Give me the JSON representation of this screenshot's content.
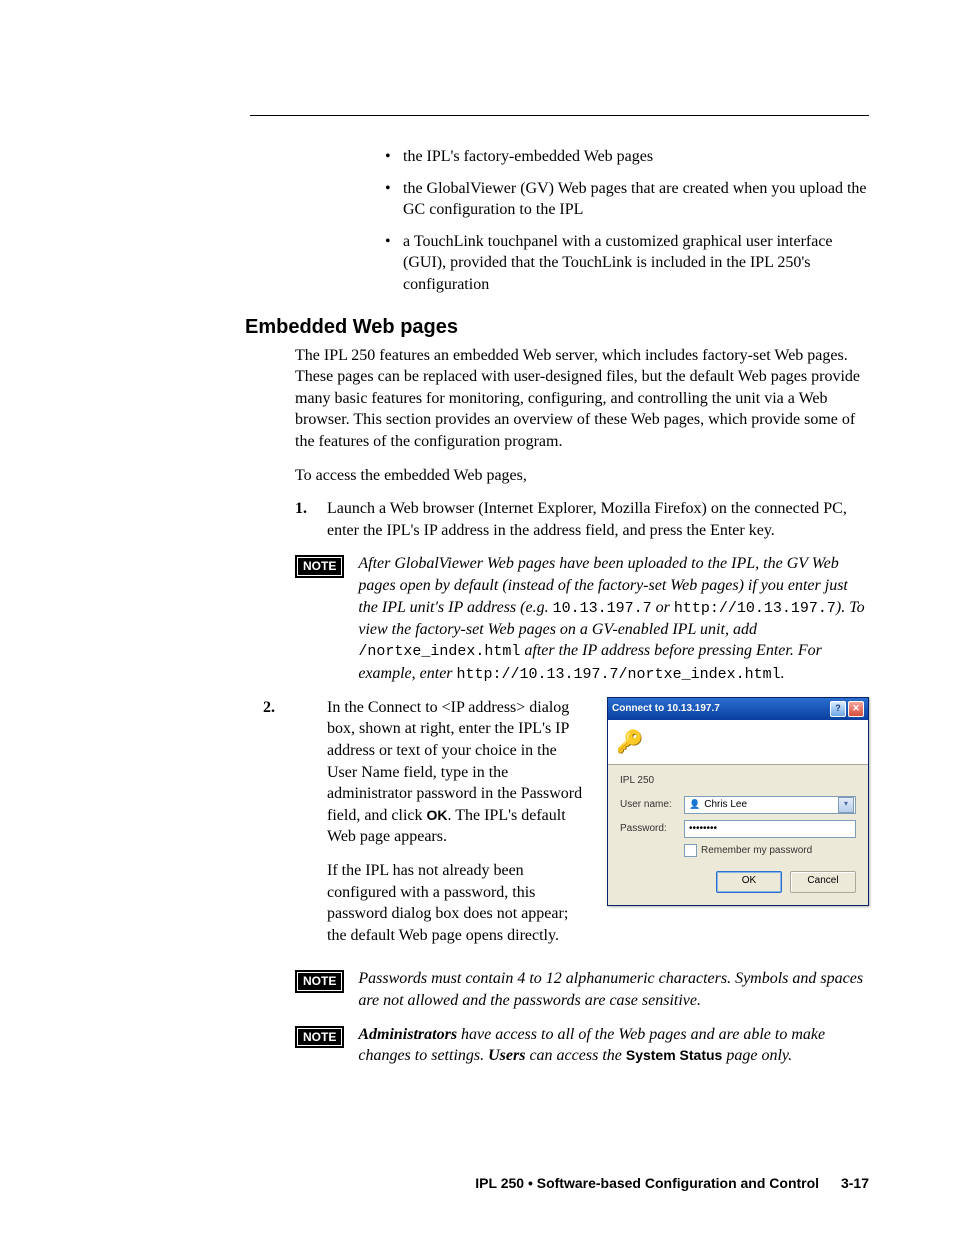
{
  "bullets": {
    "b1": "the IPL's factory-embedded Web pages",
    "b2": "the GlobalViewer (GV) Web pages that are created when you upload the GC configuration to the IPL",
    "b3": "a TouchLink touchpanel with a customized graphical user interface (GUI), provided that the TouchLink is included in the IPL 250's configuration"
  },
  "heading": "Embedded Web pages",
  "intro": "The IPL 250 features an embedded Web server, which includes factory-set Web pages.  These pages can be replaced with user-designed files, but the default Web pages provide many basic features for monitoring, configuring, and controlling the unit via a Web browser.  This section provides an overview of these Web pages, which provide some of the features of the configuration program.",
  "access_line": "To access the embedded Web pages,",
  "step1_num": "1.",
  "step1_text": "Launch a Web browser (Internet Explorer, Mozilla Firefox) on the connected PC, enter the IPL's IP address in the address field, and press the Enter key.",
  "note_badge": "NOTE",
  "note1": {
    "a": "After GlobalViewer Web pages have been uploaded to the IPL, the GV Web pages open by default (instead of the factory-set Web pages) if you enter just the IPL unit's IP address (e.g. ",
    "ip1": "10.13.197.7",
    "or": " or ",
    "ip2": "http://10.13.197.7",
    "b": "). To view the factory-set Web pages on a GV-enabled IPL unit, add ",
    "path1": "/nortxe_index.html",
    "c": " after the IP address before pressing Enter.  For example, enter ",
    "path2": "http://10.13.197.7/nortxe_index.html",
    "d": "."
  },
  "step2_num": "2.",
  "step2_a": "In the Connect to <IP address> dialog box, shown at right, enter the IPL's IP address or text of your choice in the User Name field, type in the administrator password in the Password field, and click ",
  "step2_ok": "OK",
  "step2_b": ".  The IPL's default Web page appears.",
  "step2_follow": "If the IPL has not already been configured with a password, this password dialog box does not appear; the default Web page opens directly.",
  "note2": "Passwords must contain 4 to 12 alphanumeric characters.  Symbols and spaces are not allowed and the passwords are case sensitive.",
  "note3": {
    "a": "Administrators",
    "b": " have access to all of the Web pages and are able to make changes to settings.  ",
    "c": "Users",
    "d": " can access the ",
    "e": "System Status",
    "f": " page only."
  },
  "dialog": {
    "title": "Connect to 10.13.197.7",
    "help": "?",
    "close": "✕",
    "app": "IPL 250",
    "username_label": "User name:",
    "username_value": "Chris Lee",
    "password_label": "Password:",
    "password_value": "••••••••",
    "remember": "Remember my password",
    "ok": "OK",
    "cancel": "Cancel"
  },
  "footer": {
    "text": "IPL 250 • Software-based Configuration and Control",
    "page": "3-17"
  }
}
